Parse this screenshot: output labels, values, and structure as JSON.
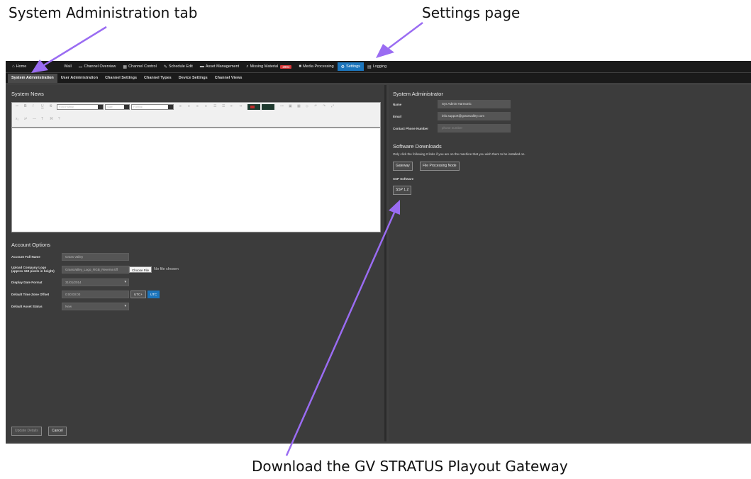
{
  "callouts": {
    "admin_tab": "System Administration tab",
    "settings_page": "Settings page",
    "download": "Download the GV STRATUS Playout Gateway"
  },
  "colors": {
    "arrow": "#9a6cf2",
    "nav_active": "#1c75bc",
    "badge": "#d9383a"
  },
  "nav": {
    "home": {
      "label": "Home",
      "icon": "home-icon"
    },
    "wall": {
      "label": "Wall",
      "icon": "monitor-icon"
    },
    "channel_overview": {
      "label": "Channel Overview",
      "icon": "monitor-icon"
    },
    "channel_control": {
      "label": "Channel Control",
      "icon": "grid-icon"
    },
    "schedule_edit": {
      "label": "Schedule Edit",
      "icon": "edit-icon"
    },
    "asset_management": {
      "label": "Asset Management",
      "icon": "folder-icon"
    },
    "missing_material": {
      "label": "Missing Material",
      "icon": "search-icon",
      "badge": "2894"
    },
    "media_processing": {
      "label": "Media Processing",
      "icon": "film-icon"
    },
    "settings": {
      "label": "Settings",
      "icon": "gear-icon"
    },
    "logging": {
      "label": "Logging",
      "icon": "list-icon"
    }
  },
  "subtabs": {
    "system_administration": "System Administration",
    "user_administration": "User Administration",
    "channel_settings": "Channel Settings",
    "channel_types": "Channel Types",
    "device_settings": "Device Settings",
    "channel_views": "Channel Views"
  },
  "system_news": {
    "title": "System News",
    "font_family_placeholder": "Font Family",
    "size_placeholder": "Size",
    "format_placeholder": "Format"
  },
  "account_options": {
    "title": "Account Options",
    "full_name_label": "Account Full Name",
    "full_name_value": "Grass Valley",
    "logo_label_line1": "Upload Company Logo",
    "logo_label_line2": "(approx 163 pixels in height)",
    "logo_value": "GrassValley_Logo_RGB_Reverse.tiff",
    "choose_file": "Choose File",
    "no_file": "No file chosen",
    "date_format_label": "Display Date Format",
    "date_format_value": "31/01/2014",
    "tz_label": "Default Time Zone Offset",
    "tz_value": "0:00:00:00",
    "utc_plus": "UTC+",
    "utc": "UTC",
    "asset_status_label": "Default Asset Status",
    "asset_status_value": "New"
  },
  "footer": {
    "update": "Update Details",
    "cancel": "Cancel"
  },
  "system_administrator": {
    "title": "System Administrator",
    "name_label": "Name",
    "name_value": "Sys Admin Harmonic",
    "email_label": "Email",
    "email_value": "info.support@grassvalley.com",
    "phone_label": "Contact Phone Number",
    "phone_placeholder": "phone number"
  },
  "software_downloads": {
    "title": "Software Downloads",
    "description": "Only click the following 2 links if you are on the machine that you wish them to be installed on.",
    "gateway": "Gateway",
    "file_processing_node": "File Processing Node",
    "ssp_label": "SSP Software",
    "ssp_button": "SSP 1.2"
  }
}
